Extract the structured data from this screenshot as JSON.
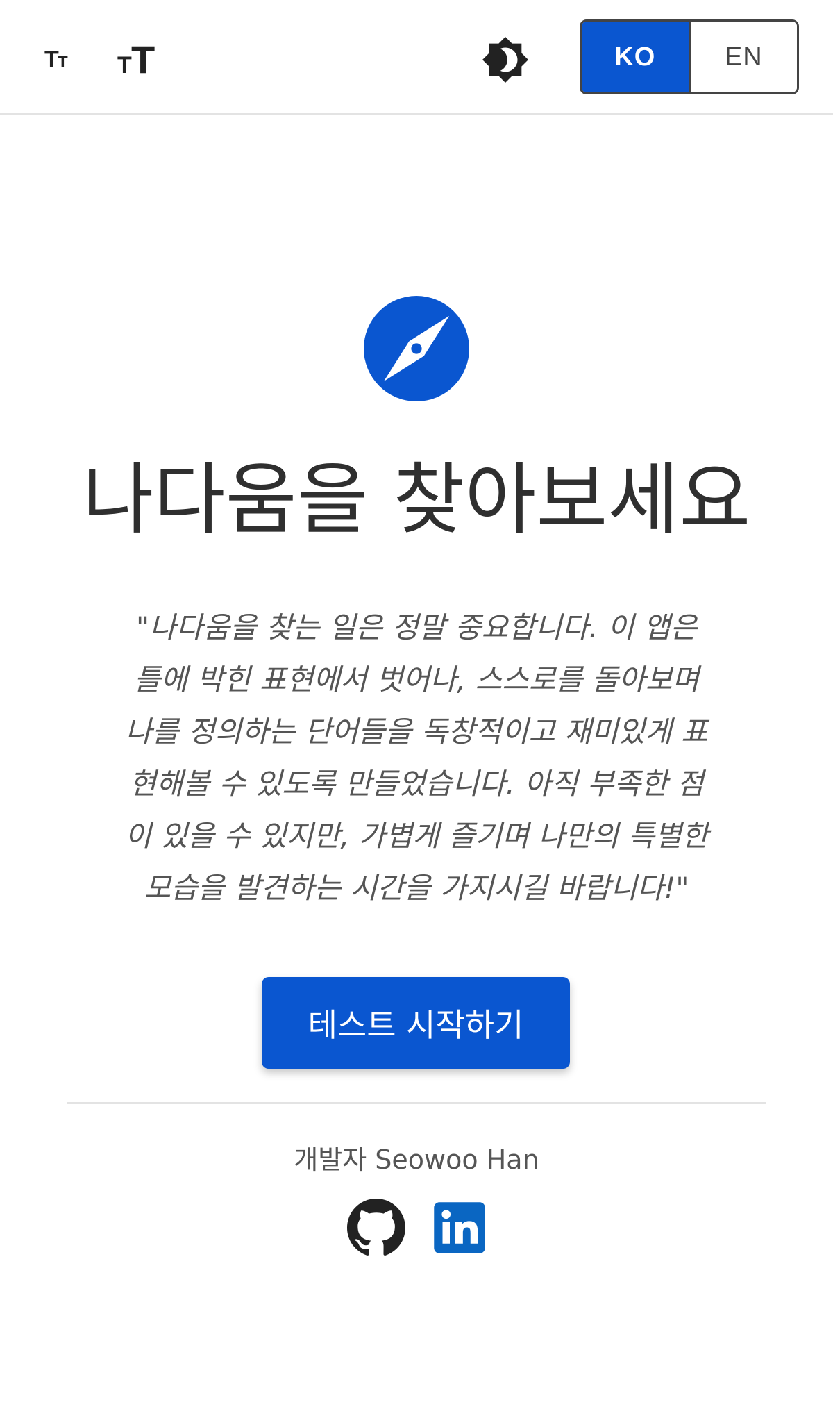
{
  "topbar": {
    "font_decrease": {
      "icon": "text-size-small-icon",
      "glyph": "Tт"
    },
    "font_increase": {
      "icon": "text-size-large-icon",
      "glyph": "тT"
    },
    "theme_toggle": {
      "icon": "brightness-icon"
    },
    "language": {
      "options": [
        "KO",
        "EN"
      ],
      "selected": "KO"
    }
  },
  "main": {
    "icon": "compass-icon",
    "title": "나다움을 찾아보세요",
    "quote_lines": [
      "\"나다움을 찾는 일은 정말 중요합니다. 이 앱은",
      "틀에 박힌 표현에서 벗어나, 스스로를 돌아보며",
      "나를 정의하는 단어들을 독창적이고 재미있게 표",
      "현해볼 수 있도록 만들었습니다. 아직 부족한 점",
      "이 있을 수 있지만, 가볍게 즐기며 나만의 특별한",
      "모습을 발견하는 시간을 가지시길 바랍니다!\""
    ],
    "start_button_label": "테스트 시작하기"
  },
  "footer": {
    "credit": "개발자 Seowoo Han",
    "links": [
      {
        "icon": "github-icon"
      },
      {
        "icon": "linkedin-icon"
      }
    ]
  },
  "colors": {
    "accent": "#0a56d0",
    "text": "#333333",
    "border": "#e3e3e3"
  }
}
